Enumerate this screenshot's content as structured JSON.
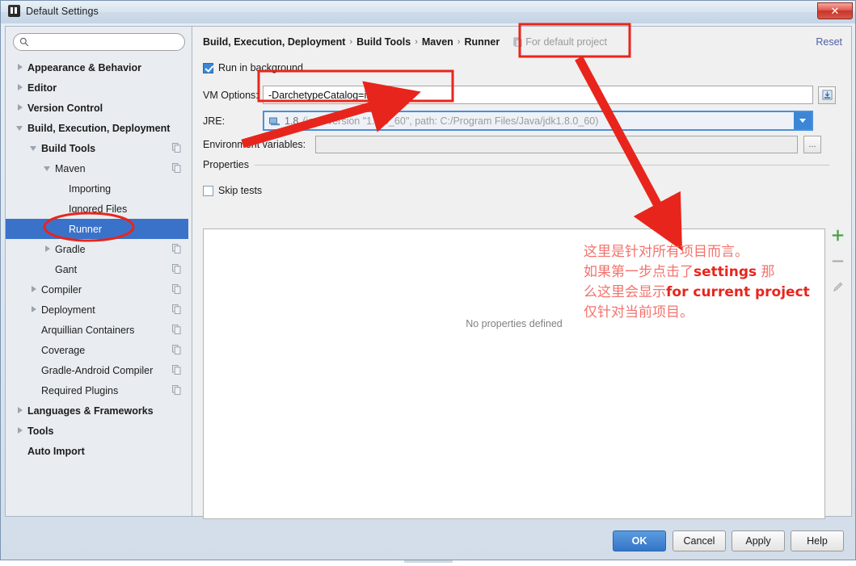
{
  "window": {
    "title": "Default Settings",
    "app_icon": "intellij-idea-icon",
    "close_label": "✕",
    "ghost_text": ""
  },
  "sidebar": {
    "search": {
      "value": "",
      "placeholder": "",
      "icon": "search-icon"
    },
    "items": [
      {
        "label": "Appearance & Behavior",
        "indent": 0,
        "twisty": "closed",
        "bold": true,
        "copy": false,
        "selected": false
      },
      {
        "label": "Editor",
        "indent": 0,
        "twisty": "closed",
        "bold": true,
        "copy": false,
        "selected": false
      },
      {
        "label": "Version Control",
        "indent": 0,
        "twisty": "closed",
        "bold": true,
        "copy": false,
        "selected": false
      },
      {
        "label": "Build, Execution, Deployment",
        "indent": 0,
        "twisty": "open",
        "bold": true,
        "copy": false,
        "selected": false
      },
      {
        "label": "Build Tools",
        "indent": 1,
        "twisty": "open",
        "bold": true,
        "copy": true,
        "selected": false
      },
      {
        "label": "Maven",
        "indent": 2,
        "twisty": "open",
        "bold": false,
        "copy": true,
        "selected": false
      },
      {
        "label": "Importing",
        "indent": 3,
        "twisty": "none",
        "bold": false,
        "copy": false,
        "selected": false
      },
      {
        "label": "Ignored Files",
        "indent": 3,
        "twisty": "none",
        "bold": false,
        "copy": false,
        "selected": false
      },
      {
        "label": "Runner",
        "indent": 3,
        "twisty": "none",
        "bold": false,
        "copy": false,
        "selected": true
      },
      {
        "label": "Gradle",
        "indent": 2,
        "twisty": "closed",
        "bold": false,
        "copy": true,
        "selected": false
      },
      {
        "label": "Gant",
        "indent": 2,
        "twisty": "none",
        "bold": false,
        "copy": true,
        "selected": false
      },
      {
        "label": "Compiler",
        "indent": 1,
        "twisty": "closed",
        "bold": false,
        "copy": true,
        "selected": false
      },
      {
        "label": "Deployment",
        "indent": 1,
        "twisty": "closed",
        "bold": false,
        "copy": true,
        "selected": false
      },
      {
        "label": "Arquillian Containers",
        "indent": 1,
        "twisty": "none",
        "bold": false,
        "copy": true,
        "selected": false
      },
      {
        "label": "Coverage",
        "indent": 1,
        "twisty": "none",
        "bold": false,
        "copy": true,
        "selected": false
      },
      {
        "label": "Gradle-Android Compiler",
        "indent": 1,
        "twisty": "none",
        "bold": false,
        "copy": true,
        "selected": false
      },
      {
        "label": "Required Plugins",
        "indent": 1,
        "twisty": "none",
        "bold": false,
        "copy": true,
        "selected": false
      },
      {
        "label": "Languages & Frameworks",
        "indent": 0,
        "twisty": "closed",
        "bold": true,
        "copy": false,
        "selected": false
      },
      {
        "label": "Tools",
        "indent": 0,
        "twisty": "closed",
        "bold": true,
        "copy": false,
        "selected": false
      },
      {
        "label": "Auto Import",
        "indent": 0,
        "twisty": "none",
        "bold": true,
        "copy": false,
        "selected": false
      }
    ]
  },
  "pane": {
    "breadcrumb": {
      "parts": [
        "Build, Execution, Deployment",
        "Build Tools",
        "Maven",
        "Runner"
      ],
      "separator": "›",
      "scope_text": "For default project",
      "scope_icon": "project-scope-icon"
    },
    "reset_label": "Reset",
    "run_in_background": {
      "label": "Run in background",
      "checked": true
    },
    "vm_options": {
      "label": "VM Options:",
      "label_mnemonic": "V",
      "value": "-DarchetypeCatalog=internal",
      "expand_button_icon": "insert-macro-icon"
    },
    "jre": {
      "label": "JRE:",
      "label_mnemonic": "J",
      "icon": "jdk-icon",
      "version": "1.8",
      "detail": "(java version \"1.8.0_60\", path: C:/Program Files/Java/jdk1.8.0_60)",
      "dropdown_icon": "chevron-down-icon"
    },
    "environment_variables": {
      "label": "Environment variables:",
      "label_mnemonic": "E",
      "value": "",
      "browse_label": "..."
    },
    "properties_group": "Properties",
    "skip_tests": {
      "label": "Skip tests",
      "checked": false,
      "mnemonic": "t"
    },
    "properties_table": {
      "empty_message": "No properties defined"
    },
    "table_tools": [
      {
        "name": "add-property-button",
        "icon": "plus-icon",
        "glyph": "+",
        "color": "#4a9e4a"
      },
      {
        "name": "remove-property-button",
        "icon": "minus-icon",
        "glyph": "−",
        "color": "#9a9a9a"
      },
      {
        "name": "edit-property-button",
        "icon": "pencil-icon",
        "glyph": "✎",
        "color": "#b0b0b0"
      }
    ]
  },
  "footer": {
    "ok": "OK",
    "cancel": "Cancel",
    "apply": "Apply",
    "help": "Help"
  },
  "annotations": {
    "accent_color": "#e8251c",
    "note_color": "#f2736d",
    "note_lines": [
      "这里是针对所有项目而言。",
      "如果第一步点击了settings 那",
      "么这里会显示for current project",
      "仅针对当前项目。"
    ],
    "note_emphasis": [
      "settings",
      "for current project"
    ],
    "shapes": [
      {
        "name": "vm-options-highlight-box",
        "type": "rect"
      },
      {
        "name": "for-default-project-highlight-box",
        "type": "rect"
      },
      {
        "name": "runner-highlight-ellipse",
        "type": "ellipse"
      },
      {
        "name": "arrow-to-vm-options",
        "type": "arrow"
      },
      {
        "name": "arrow-to-note",
        "type": "arrow"
      }
    ]
  }
}
